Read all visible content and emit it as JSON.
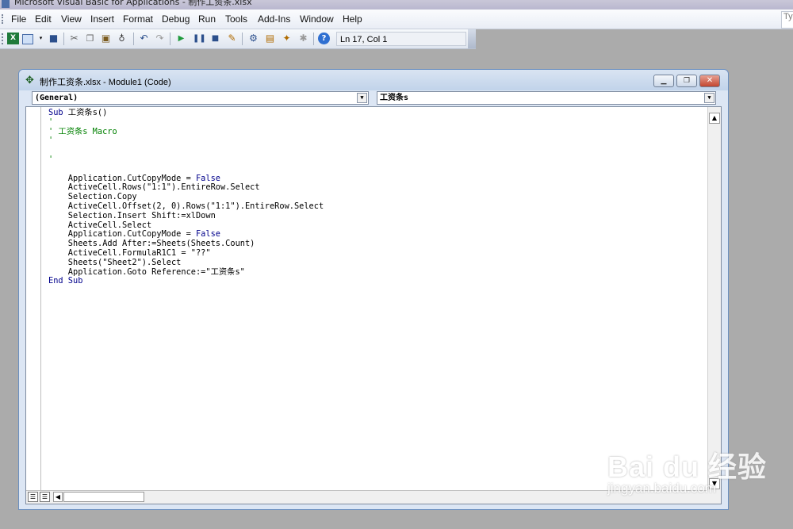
{
  "app": {
    "title": "Microsoft Visual Basic for Applications - 制作工资条.xlsx"
  },
  "menu": [
    {
      "key": "file",
      "label": "File"
    },
    {
      "key": "edit",
      "label": "Edit"
    },
    {
      "key": "view",
      "label": "View"
    },
    {
      "key": "insert",
      "label": "Insert"
    },
    {
      "key": "format",
      "label": "Format"
    },
    {
      "key": "debug",
      "label": "Debug"
    },
    {
      "key": "run",
      "label": "Run"
    },
    {
      "key": "tools",
      "label": "Tools"
    },
    {
      "key": "addins",
      "label": "Add-Ins"
    },
    {
      "key": "window",
      "label": "Window"
    },
    {
      "key": "help",
      "label": "Help"
    }
  ],
  "help_box": "Typ",
  "toolbar": {
    "position": "Ln 17, Col 1"
  },
  "code_window": {
    "title": "制作工资条.xlsx - Module1 (Code)",
    "object_combo": "(General)",
    "procedure_combo": "工资条s",
    "code_lines": [
      {
        "k": "kw",
        "t": "Sub 工资条s()"
      },
      {
        "k": "cm",
        "t": "'"
      },
      {
        "k": "cm",
        "t": "' 工资条s Macro"
      },
      {
        "k": "cm",
        "t": "'"
      },
      {
        "k": "",
        "t": ""
      },
      {
        "k": "cm",
        "t": "'"
      },
      {
        "k": "",
        "t": ""
      },
      {
        "k": "",
        "t": "    Application.CutCopyMode = False"
      },
      {
        "k": "",
        "t": "    ActiveCell.Rows(\"1:1\").EntireRow.Select"
      },
      {
        "k": "",
        "t": "    Selection.Copy"
      },
      {
        "k": "",
        "t": "    ActiveCell.Offset(2, 0).Rows(\"1:1\").EntireRow.Select"
      },
      {
        "k": "",
        "t": "    Selection.Insert Shift:=xlDown"
      },
      {
        "k": "",
        "t": "    ActiveCell.Select"
      },
      {
        "k": "",
        "t": "    Application.CutCopyMode = False"
      },
      {
        "k": "",
        "t": "    Sheets.Add After:=Sheets(Sheets.Count)"
      },
      {
        "k": "",
        "t": "    ActiveCell.FormulaR1C1 = \"??\""
      },
      {
        "k": "",
        "t": "    Sheets(\"Sheet2\").Select"
      },
      {
        "k": "",
        "t": "    Application.Goto Reference:=\"工资条s\""
      },
      {
        "k": "kw",
        "t": "End Sub"
      }
    ]
  },
  "watermark": {
    "brand": "Bai du 经验",
    "url": "jingyan.baidu.com"
  }
}
